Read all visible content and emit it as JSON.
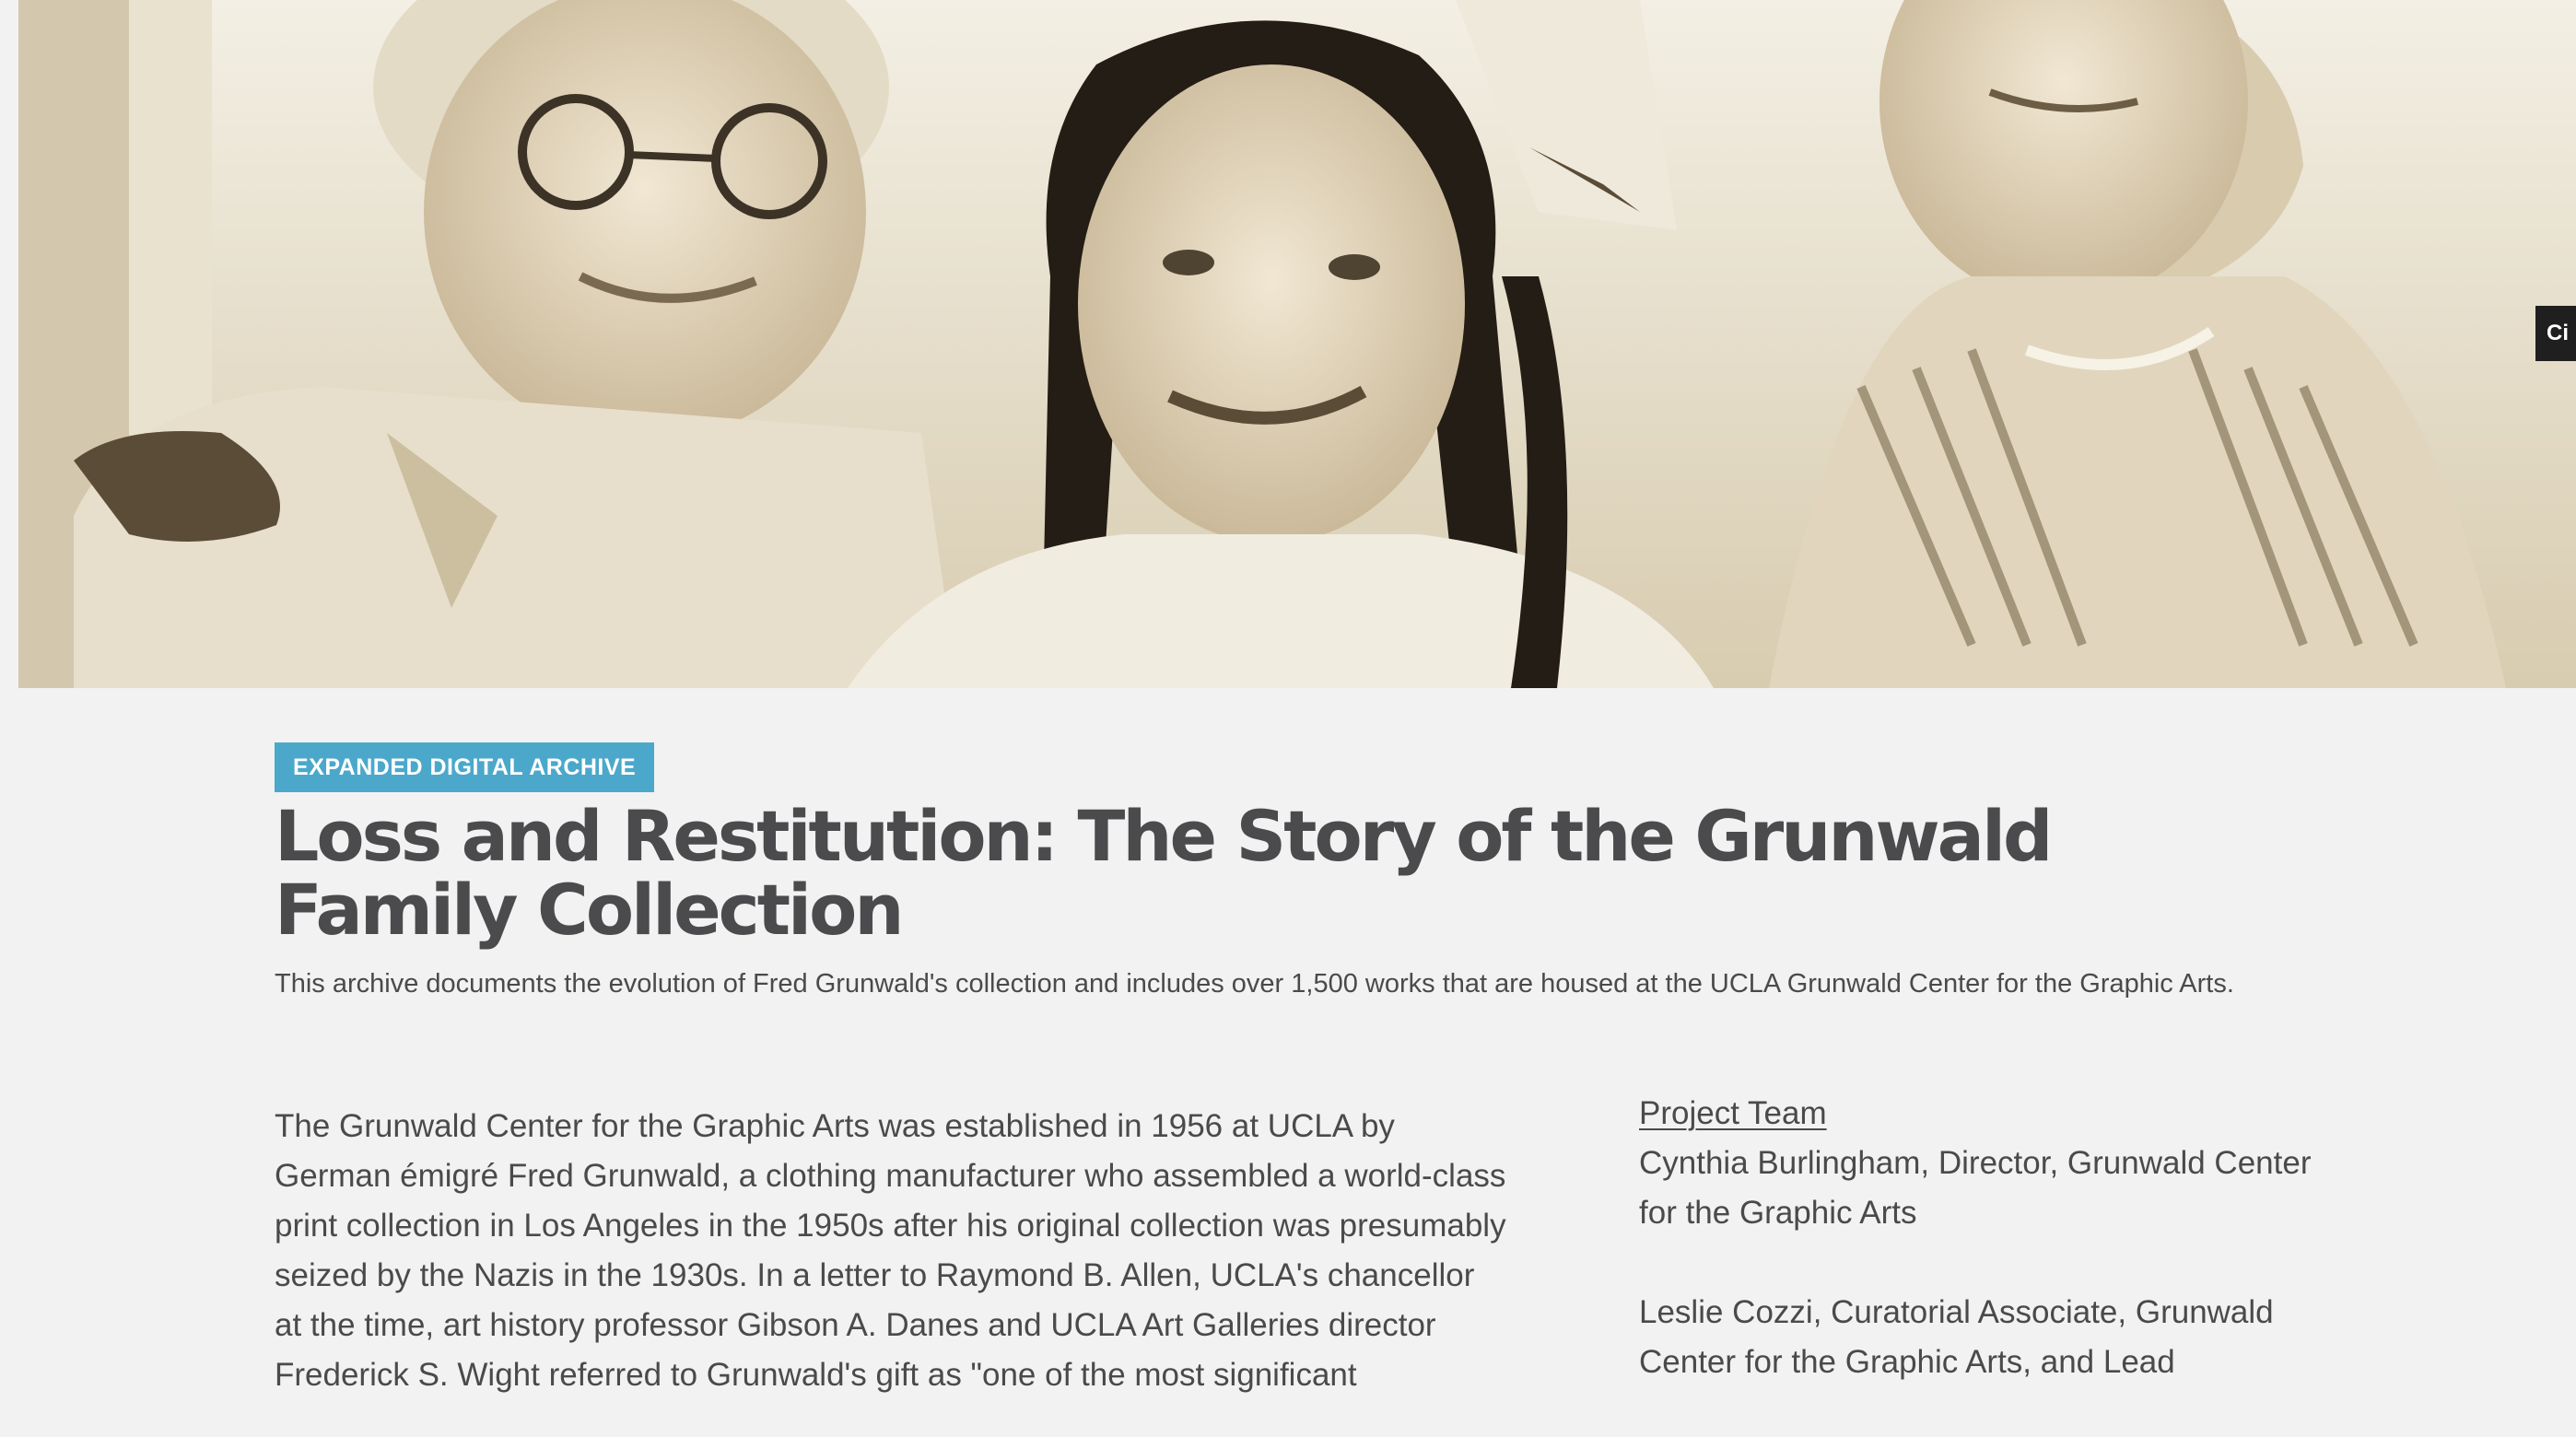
{
  "hero": {
    "image_subject": "sepia photograph of three smiling girls",
    "cite_tab_label": "Ci"
  },
  "header": {
    "badge": "EXPANDED DIGITAL ARCHIVE",
    "title": "Loss and Restitution: The Story of the Grunwald Family Collection",
    "subtitle": "This archive documents the evolution of Fred Grunwald's collection and includes over 1,500 works that are housed at the UCLA Grunwald Center for the Graphic Arts."
  },
  "article": {
    "body": "The Grunwald Center for the Graphic Arts was established in 1956 at UCLA by German émigré Fred Grunwald, a clothing manufacturer who assembled a world-class print collection in Los Angeles in the 1950s after his original collection was presumably seized by the Nazis in the 1930s. In a letter to Raymond B. Allen, UCLA's chancellor at the time, art history professor Gibson A. Danes and UCLA Art Galleries director Frederick S. Wight referred to Grunwald's gift as \"one of the most significant"
  },
  "sidebar": {
    "team_heading": "Project Team",
    "members": [
      "Cynthia Burlingham, Director, Grunwald Center for the Graphic Arts",
      "Leslie Cozzi, Curatorial Associate, Grunwald Center for the Graphic Arts, and Lead"
    ]
  },
  "colors": {
    "badge_bg": "#4ba8cb",
    "title_text": "#4b4b4d",
    "page_bg": "#f2f2f2"
  }
}
